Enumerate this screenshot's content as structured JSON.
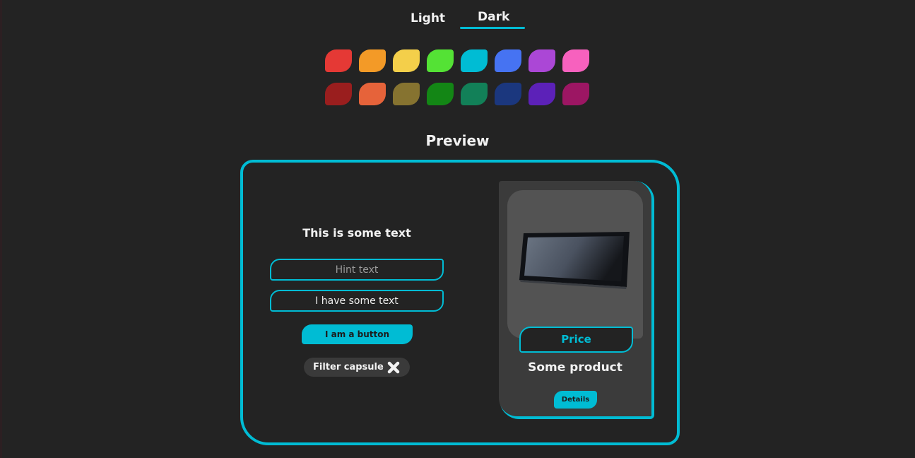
{
  "tabs": {
    "light_label": "Light",
    "dark_label": "Dark",
    "selected": "Dark"
  },
  "palette": {
    "row1": [
      "#e53935",
      "#f39a27",
      "#f4cf4a",
      "#54e235",
      "#00bcd4",
      "#4673f2",
      "#ab47d6",
      "#f761be"
    ],
    "row2": [
      "#9a1e1e",
      "#e6633a",
      "#867330",
      "#138615",
      "#128058",
      "#1b377e",
      "#5c21b8",
      "#9c1663"
    ]
  },
  "preview": {
    "title": "Preview",
    "accent": "#00bcd4",
    "sample_text": "This is some text",
    "hint_placeholder": "Hint text",
    "filled_value": "I have some text",
    "button_label": "I am a button",
    "filter_label": "Filter capsule",
    "filter_icon": "close-icon"
  },
  "product_card": {
    "image_icon": "tablet-image",
    "price_label": "Price",
    "name": "Some product",
    "details_label": "Details"
  }
}
